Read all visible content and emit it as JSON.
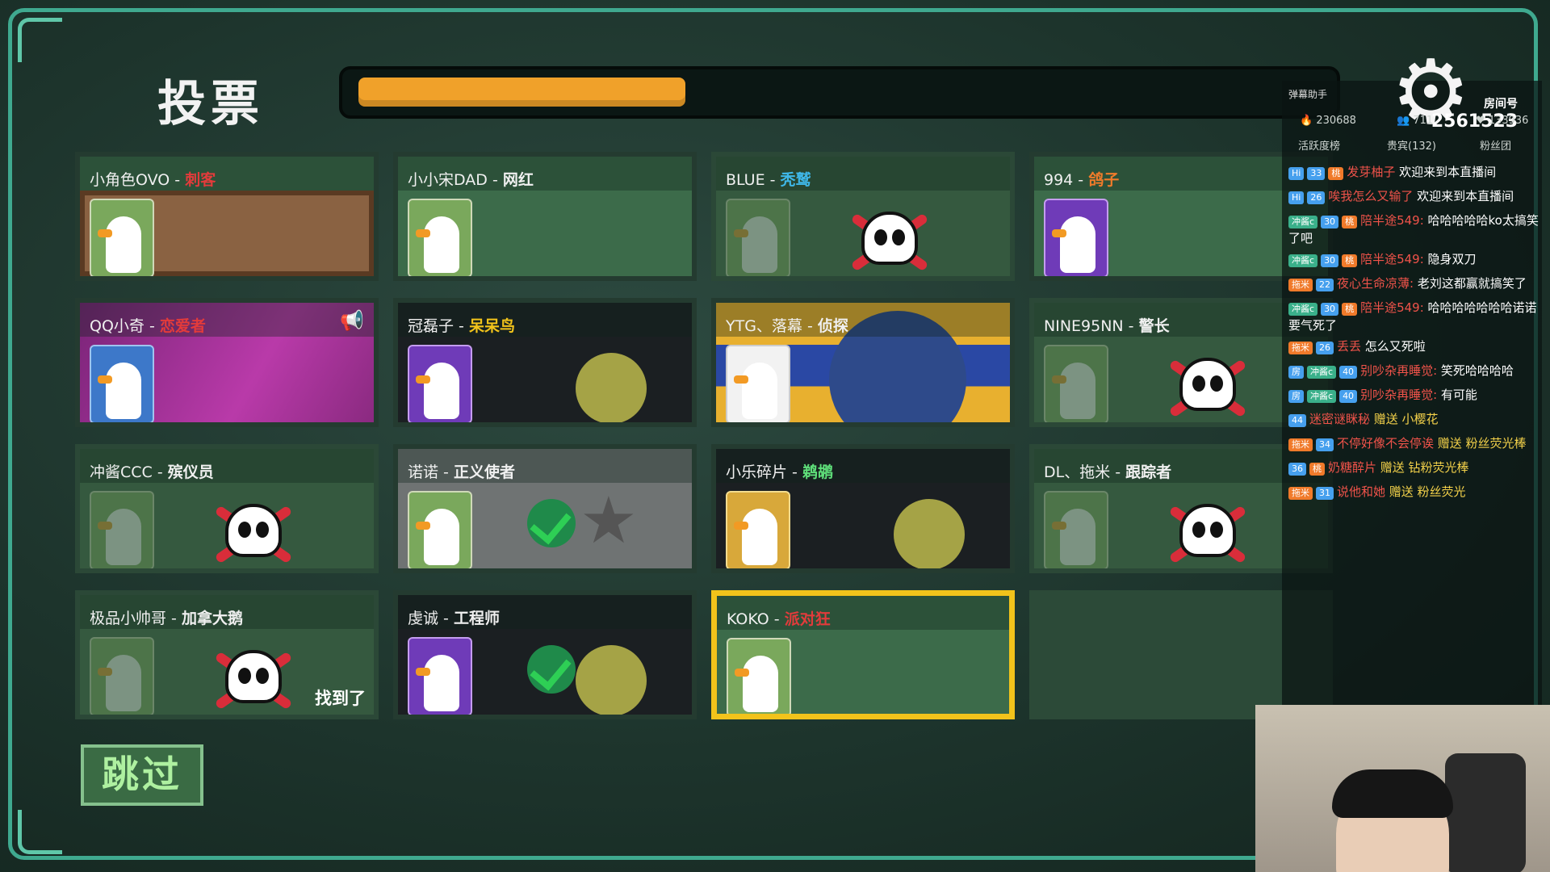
{
  "header": {
    "title": "投票",
    "timer_fraction": 0.34
  },
  "players": [
    {
      "name": "小角色OVO",
      "role": "刺客",
      "role_color": "#e33b3b",
      "state": "alive",
      "bg": "wood",
      "avatar": "blue-goose-tophat"
    },
    {
      "name": "小小宋DAD",
      "role": "网红",
      "role_color": "#f0f0f0",
      "state": "alive",
      "bg": "plain",
      "avatar": "duck-hat"
    },
    {
      "name": "BLUE",
      "role": "秃鹫",
      "role_color": "#3fb7e8",
      "state": "dead",
      "bg": "plain",
      "avatar": "bun"
    },
    {
      "name": "994",
      "role": "鸽子",
      "role_color": "#f07b2a",
      "state": "alive",
      "bg": "plain",
      "avatar": "red-goose"
    },
    {
      "name": "QQ小奇",
      "role": "恋爱者",
      "role_color": "#e33b3b",
      "state": "alive",
      "bg": "pink",
      "avatar": "white-goose",
      "megaphone": true
    },
    {
      "name": "冠磊子",
      "role": "呆呆鸟",
      "role_color": "#f2c31b",
      "state": "alive",
      "bg": "night",
      "avatar": "anubis"
    },
    {
      "name": "YTG、落幕",
      "role": "侦探",
      "role_color": "#f0f0f0",
      "state": "alive",
      "bg": "space",
      "avatar": "tiger-card"
    },
    {
      "name": "NINE95NN",
      "role": "警长",
      "role_color": "#f0f0f0",
      "state": "dead",
      "bg": "plain",
      "avatar": "duck-fedora"
    },
    {
      "name": "冲酱CCC",
      "role": "殡仪员",
      "role_color": "#f0f0f0",
      "state": "dead",
      "bg": "plain",
      "avatar": "red-duck"
    },
    {
      "name": "诺诺",
      "role": "正义使者",
      "role_color": "#f0f0f0",
      "state": "voted",
      "bg": "grey",
      "avatar": "brown-duck"
    },
    {
      "name": "小乐碎片",
      "role": "鹈鹕",
      "role_color": "#5fe07a",
      "state": "alive",
      "bg": "night",
      "avatar": "lady-goose"
    },
    {
      "name": "DL、拖米",
      "role": "跟踪者",
      "role_color": "#f0f0f0",
      "state": "dead",
      "bg": "plain",
      "avatar": "green-duck"
    },
    {
      "name": "极品小帅哥",
      "role": "加拿大鹅",
      "role_color": "#f0f0f0",
      "state": "dead",
      "bg": "plain",
      "avatar": "grey-duck",
      "found": "找到了"
    },
    {
      "name": "虔诚",
      "role": "工程师",
      "role_color": "#f0f0f0",
      "state": "voted",
      "bg": "night",
      "avatar": "cool-goose"
    },
    {
      "name": "KOKO",
      "role": "派对狂",
      "role_color": "#e33b3b",
      "state": "alive",
      "bg": "plain",
      "avatar": "penguin-cat",
      "selected": true
    }
  ],
  "skip_label": "跳过",
  "overlay": {
    "assist_label": "弹幕助手",
    "room_label": "房间号",
    "room_number": "2561523",
    "stats": {
      "hot": "230688",
      "fans_online": "711",
      "likes": "133936"
    },
    "tabs": [
      "活跃度榜",
      "贵宾(132)",
      "粉丝团"
    ],
    "messages": [
      {
        "badges": [
          "Hi",
          "33",
          "桃"
        ],
        "name": "发芽柚子",
        "text": "欢迎来到本直播间"
      },
      {
        "badges": [
          "Hi",
          "26"
        ],
        "name": "唉我怎么又输了",
        "text": "欢迎来到本直播间"
      },
      {
        "badges": [
          "冲酱c",
          "30",
          "桃"
        ],
        "name": "陪半途549:",
        "text": "哈哈哈哈哈ko太搞笑了吧"
      },
      {
        "badges": [
          "冲酱c",
          "30",
          "桃"
        ],
        "name": "陪半途549:",
        "text": "隐身双刀"
      },
      {
        "badges": [
          "拖米",
          "22"
        ],
        "name": "夜心生命凉薄:",
        "text": "老刘这都赢就搞笑了"
      },
      {
        "badges": [
          "冲酱c",
          "30",
          "桃"
        ],
        "name": "陪半途549:",
        "text": "哈哈哈哈哈哈哈诺诺要气死了"
      },
      {
        "badges": [
          "拖米",
          "26"
        ],
        "name": "丢丢",
        "text": "怎么又死啦"
      },
      {
        "badges": [
          "房",
          "冲酱c",
          "40"
        ],
        "name": "别吵杂再睡觉:",
        "text": "笑死哈哈哈哈"
      },
      {
        "badges": [
          "房",
          "冲酱c",
          "40"
        ],
        "name": "别吵杂再睡觉:",
        "text": "有可能"
      },
      {
        "badges": [
          "44"
        ],
        "name": "迷密谜眯秘",
        "text": "赠送 小樱花",
        "gift": true
      },
      {
        "badges": [
          "拖米",
          "34"
        ],
        "name": "不停好像不会停诶",
        "text": "赠送 粉丝荧光棒",
        "gift": true
      },
      {
        "badges": [
          "36",
          "桃"
        ],
        "name": "奶糖醉片",
        "text": "赠送 钻粉荧光棒",
        "gift": true
      },
      {
        "badges": [
          "拖米",
          "31"
        ],
        "name": "说他和她",
        "text": "赠送 粉丝荧光",
        "gift": true
      }
    ]
  },
  "colors": {
    "accent": "#f0a12a",
    "frame": "#3fa98f",
    "selected": "#f2c31b",
    "skip": "#aef0a0"
  }
}
